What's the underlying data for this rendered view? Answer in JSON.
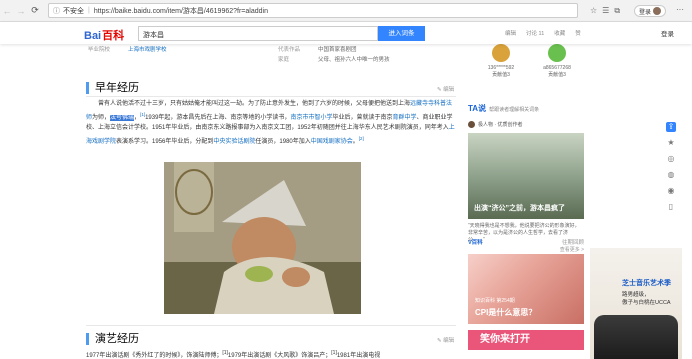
{
  "browser": {
    "security": "不安全",
    "url": "https://baike.baidu.com/item/游本昌/4619962?fr=aladdin",
    "login": "登录"
  },
  "header": {
    "logo_bai": "Bai",
    "logo_paw": "百科",
    "search_value": "游本昌",
    "search_button": "进入词条",
    "actions": [
      "编辑",
      "讨论 11",
      "收藏",
      "赞"
    ],
    "login": "登录"
  },
  "infotable": [
    {
      "k": "毕业院校",
      "v": "上海市戏剧学校",
      "link": true,
      "k2": "代表作品",
      "v2": "中国首家喜剧团"
    },
    {
      "k": "",
      "v": "",
      "link": false,
      "k2": "家庭",
      "v2": "父母、祖孙六人中唯一的男孩"
    }
  ],
  "sections": {
    "s1_title": "早年经历",
    "edit": "编辑",
    "s2_title": "演艺经历"
  },
  "para1": {
    "a": "曾有人说他活不过十三岁，只有姑姑俺才能叫过这一劫。为了防止意外发生，他到了六岁的时候，父母便把他送到上海",
    "b": "远藏寺",
    "c": "寺科普法师",
    "d": "为师，",
    "e": "法号佛瑞",
    "f": "，",
    "sup1": "[1]",
    "g": "1939年起，游本昌先后在上海、南京等地的小学读书，",
    "h": "南京市市智小学",
    "i": "毕业后，曾",
    "j": "就读于南京",
    "k": "育群中学",
    "l": "、商业职业学校、上海立信会计学校。1951年毕业后，由南京东义路报事部为入南京文工团，1952年初随团并往上海华东人民艺术剧院演员，同年考入",
    "m": "上海戏剧学院",
    "n": "表演系学习。1956年毕业后，分配到",
    "o": "中央实验话剧院",
    "p": "任演员，1980年加入",
    "q": "中国戏剧家协会",
    "r": "。",
    "sup2": "[2]"
  },
  "para2": {
    "text": "1977年出演话剧《秀外红了的时候》，饰演陆师傅；",
    "sup": "[1]",
    "text2": "1979年出演话剧《大风歌》饰演吕产；",
    "sup2": "[1]",
    "text3": "1981年出演电视"
  },
  "sidebar": {
    "users": [
      {
        "name": "136*****592",
        "sub": "贡献值3",
        "color": "#d9a23a"
      },
      {
        "name": "a865677268",
        "sub": "贡献值3",
        "color": "#6ac04f"
      }
    ],
    "ta_logo": "TA说",
    "ta_sub": "帮跟读者理解相关词条",
    "ta_user": "极人物 · 优质创作者",
    "ta_caption": "出演“济公”之前，游本昌疯了",
    "ta_desc": "“天晓得我也是不想我，他说要把济公的形象演好，非常辛苦，以为是济公的人生哲学，去看了济公……”",
    "ta_more": "查看更多 >",
    "vbk_title": "V百科",
    "vbk_more": "往期回顾",
    "vbk_sub": "知识百科 第254期",
    "vbk_caption": "CPI是什么意思？",
    "next_label": "笑你来打开"
  },
  "ad": {
    "t1": "芝士音乐艺术季",
    "t2": "路男超级，",
    "t3": "傲子与白桃在UCCA"
  },
  "rail_icons": [
    "share-icon",
    "star-icon",
    "weibo-icon",
    "wechat-icon",
    "qq-icon",
    "phone-icon"
  ]
}
